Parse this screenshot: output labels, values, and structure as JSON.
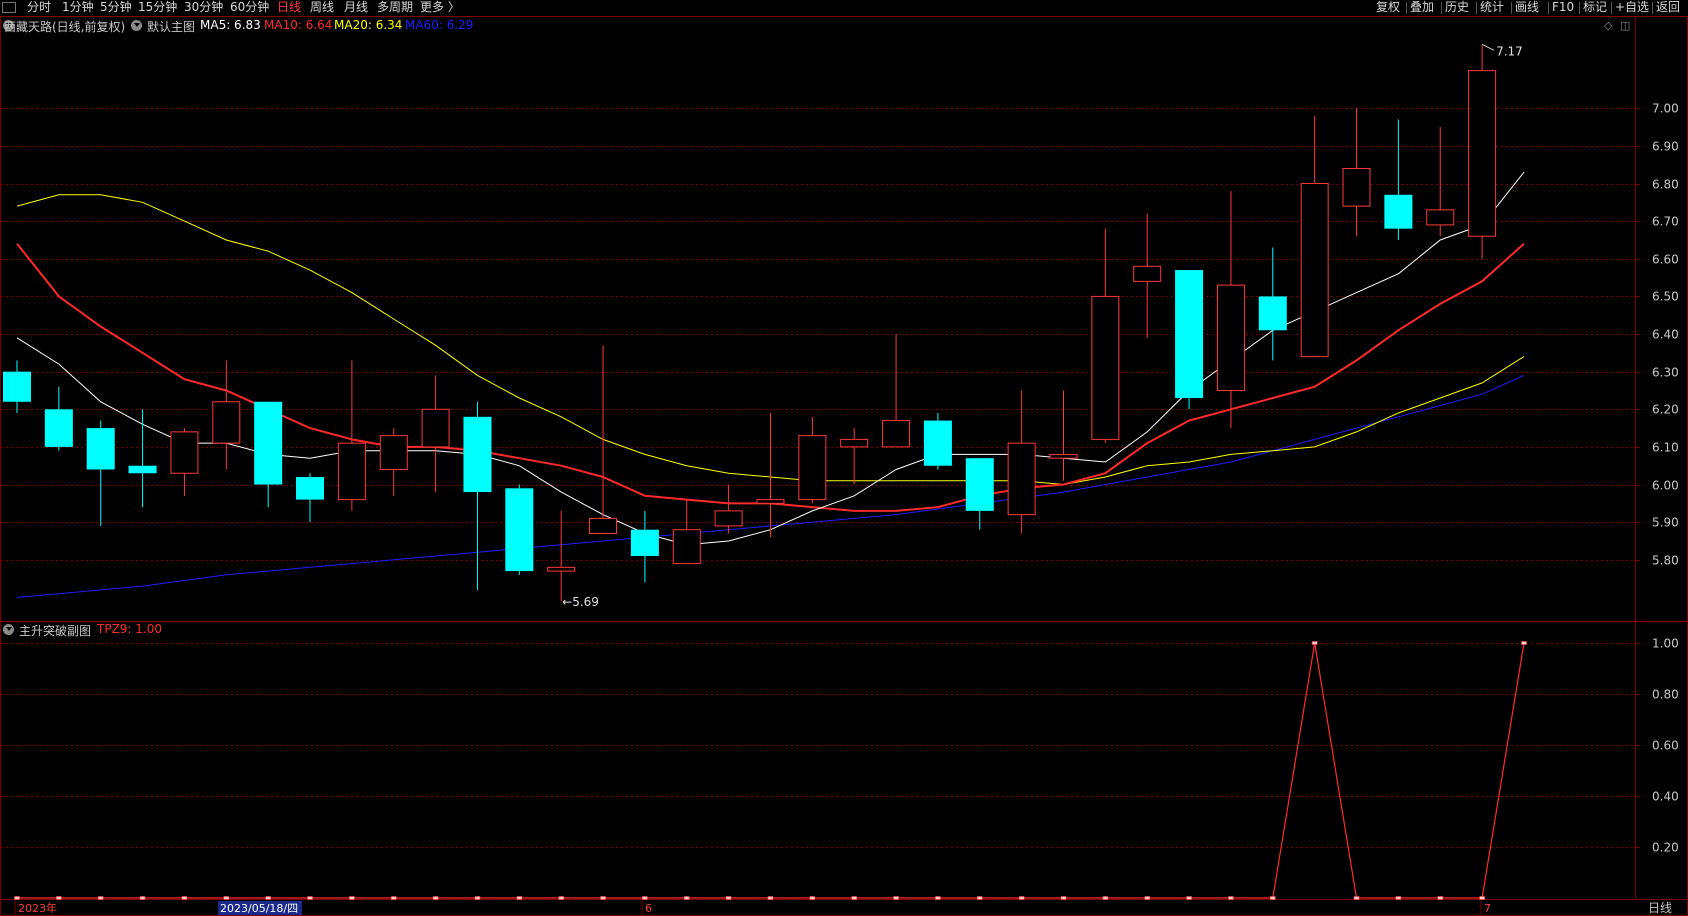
{
  "toolbar": {
    "left_items": [
      "分时",
      "1分钟",
      "5分钟",
      "15分钟",
      "30分钟",
      "60分钟",
      "日线",
      "周线",
      "月线",
      "多周期",
      "更多 〉"
    ],
    "active_item": "日线",
    "right_items": [
      "复权",
      "叠加",
      "历史",
      "统计",
      "画线",
      "F10",
      "标记",
      "+自选",
      "返回"
    ]
  },
  "main_header": {
    "stock": "西藏天路(日线,前复权)",
    "template": "默认主图",
    "ma": [
      {
        "label": "MA5: 6.83",
        "color": "#ffffff"
      },
      {
        "label": "MA10: 6.64",
        "color": "#ff2a2a"
      },
      {
        "label": "MA20: 6.34",
        "color": "#ffff00"
      },
      {
        "label": "MA60: 6.29",
        "color": "#1e1eff"
      }
    ]
  },
  "sub_header": {
    "template": "主升突破副图",
    "indicator": "TPZ9: 1.00",
    "indicator_color": "#ff2a2a"
  },
  "bottom_bar": {
    "labels": [
      "2023年",
      "6",
      "7"
    ],
    "cursor_date": "2023/05/18/四",
    "period_label": "日线"
  },
  "colors": {
    "up": "#ff3838",
    "down": "#00ffff",
    "grid": "#7a0000",
    "axis_text": "#c8c8c8"
  },
  "chart_data": {
    "type": "candlestick",
    "price_axis": {
      "ticks": [
        "5.80",
        "5.90",
        "6.00",
        "6.10",
        "6.20",
        "6.30",
        "6.40",
        "6.50",
        "6.60",
        "6.70",
        "6.80",
        "6.90",
        "7.00"
      ],
      "range": [
        5.64,
        7.2
      ]
    },
    "annotations": {
      "high": "7.17",
      "low": "5.69"
    },
    "candles": [
      {
        "o": 6.3,
        "h": 6.33,
        "l": 6.19,
        "c": 6.22
      },
      {
        "o": 6.2,
        "h": 6.26,
        "l": 6.09,
        "c": 6.1
      },
      {
        "o": 6.15,
        "h": 6.17,
        "l": 5.89,
        "c": 6.04
      },
      {
        "o": 6.05,
        "h": 6.2,
        "l": 5.94,
        "c": 6.03
      },
      {
        "o": 6.03,
        "h": 6.15,
        "l": 5.97,
        "c": 6.14
      },
      {
        "o": 6.11,
        "h": 6.33,
        "l": 6.04,
        "c": 6.22
      },
      {
        "o": 6.22,
        "h": 6.21,
        "l": 5.94,
        "c": 6.0
      },
      {
        "o": 6.02,
        "h": 6.03,
        "l": 5.9,
        "c": 5.96
      },
      {
        "o": 5.96,
        "h": 6.33,
        "l": 5.93,
        "c": 6.11
      },
      {
        "o": 6.04,
        "h": 6.15,
        "l": 5.97,
        "c": 6.13
      },
      {
        "o": 6.1,
        "h": 6.29,
        "l": 5.98,
        "c": 6.2
      },
      {
        "o": 6.18,
        "h": 6.22,
        "l": 5.72,
        "c": 5.98
      },
      {
        "o": 5.99,
        "h": 6.0,
        "l": 5.76,
        "c": 5.77
      },
      {
        "o": 5.77,
        "h": 5.93,
        "l": 5.69,
        "c": 5.78
      },
      {
        "o": 5.87,
        "h": 6.37,
        "l": 5.87,
        "c": 5.91
      },
      {
        "o": 5.88,
        "h": 5.93,
        "l": 5.74,
        "c": 5.81
      },
      {
        "o": 5.79,
        "h": 5.96,
        "l": 5.79,
        "c": 5.88
      },
      {
        "o": 5.89,
        "h": 6.0,
        "l": 5.87,
        "c": 5.93
      },
      {
        "o": 5.95,
        "h": 6.19,
        "l": 5.86,
        "c": 5.96
      },
      {
        "o": 5.96,
        "h": 6.18,
        "l": 5.95,
        "c": 6.13
      },
      {
        "o": 6.1,
        "h": 6.15,
        "l": 6.0,
        "c": 6.12
      },
      {
        "o": 6.1,
        "h": 6.4,
        "l": 6.1,
        "c": 6.17
      },
      {
        "o": 6.17,
        "h": 6.19,
        "l": 6.04,
        "c": 6.05
      },
      {
        "o": 6.07,
        "h": 6.07,
        "l": 5.88,
        "c": 5.93
      },
      {
        "o": 5.92,
        "h": 6.25,
        "l": 5.87,
        "c": 6.11
      },
      {
        "o": 6.07,
        "h": 6.25,
        "l": 6.01,
        "c": 6.08
      },
      {
        "o": 6.12,
        "h": 6.68,
        "l": 6.11,
        "c": 6.5
      },
      {
        "o": 6.54,
        "h": 6.72,
        "l": 6.39,
        "c": 6.58
      },
      {
        "o": 6.57,
        "h": 6.57,
        "l": 6.2,
        "c": 6.23
      },
      {
        "o": 6.25,
        "h": 6.78,
        "l": 6.15,
        "c": 6.53
      },
      {
        "o": 6.5,
        "h": 6.63,
        "l": 6.33,
        "c": 6.41
      },
      {
        "o": 6.34,
        "h": 6.98,
        "l": 6.34,
        "c": 6.8
      },
      {
        "o": 6.74,
        "h": 7.0,
        "l": 6.66,
        "c": 6.84
      },
      {
        "o": 6.77,
        "h": 6.97,
        "l": 6.65,
        "c": 6.68
      },
      {
        "o": 6.69,
        "h": 6.95,
        "l": 6.66,
        "c": 6.73
      },
      {
        "o": 6.66,
        "h": 7.17,
        "l": 6.6,
        "c": 7.1
      }
    ],
    "ma_series": [
      {
        "name": "MA5",
        "color": "#ffffff",
        "width": 1,
        "values": [
          6.39,
          6.32,
          6.22,
          6.16,
          6.11,
          6.11,
          6.08,
          6.07,
          6.09,
          6.09,
          6.09,
          6.08,
          6.05,
          5.98,
          5.92,
          5.87,
          5.84,
          5.85,
          5.88,
          5.93,
          5.97,
          6.04,
          6.08,
          6.08,
          6.08,
          6.07,
          6.06,
          6.14,
          6.25,
          6.33,
          6.41,
          6.46,
          6.51,
          6.56,
          6.65,
          6.69,
          6.83
        ]
      },
      {
        "name": "MA10",
        "color": "#ff2a2a",
        "width": 2,
        "values": [
          6.64,
          6.5,
          6.42,
          6.35,
          6.28,
          6.25,
          6.2,
          6.15,
          6.12,
          6.1,
          6.1,
          6.09,
          6.07,
          6.05,
          6.02,
          5.97,
          5.96,
          5.95,
          5.95,
          5.94,
          5.93,
          5.93,
          5.94,
          5.97,
          5.99,
          6.0,
          6.03,
          6.11,
          6.17,
          6.2,
          6.23,
          6.26,
          6.33,
          6.41,
          6.48,
          6.54,
          6.64
        ]
      },
      {
        "name": "MA20",
        "color": "#ffff00",
        "width": 1,
        "values": [
          6.74,
          6.77,
          6.77,
          6.75,
          6.7,
          6.65,
          6.62,
          6.57,
          6.51,
          6.44,
          6.37,
          6.29,
          6.23,
          6.18,
          6.12,
          6.08,
          6.05,
          6.03,
          6.02,
          6.01,
          6.01,
          6.01,
          6.01,
          6.01,
          6.01,
          6.0,
          6.02,
          6.05,
          6.06,
          6.08,
          6.09,
          6.1,
          6.14,
          6.19,
          6.23,
          6.27,
          6.34
        ]
      },
      {
        "name": "MA60",
        "color": "#1e1eff",
        "width": 1,
        "values": [
          5.7,
          5.71,
          5.72,
          5.73,
          5.745,
          5.76,
          5.77,
          5.78,
          5.79,
          5.8,
          5.81,
          5.82,
          5.83,
          5.84,
          5.85,
          5.86,
          5.87,
          5.88,
          5.89,
          5.9,
          5.91,
          5.92,
          5.935,
          5.95,
          5.965,
          5.98,
          6.0,
          6.02,
          6.04,
          6.06,
          6.09,
          6.12,
          6.15,
          6.18,
          6.21,
          6.24,
          6.29
        ]
      }
    ],
    "sub_chart": {
      "name": "TPZ9",
      "ticks": [
        "0.20",
        "0.40",
        "0.60",
        "0.80",
        "1.00"
      ],
      "range": [
        0,
        1.0
      ],
      "values": [
        0,
        0,
        0,
        0,
        0,
        0,
        0,
        0,
        0,
        0,
        0,
        0,
        0,
        0,
        0,
        0,
        0,
        0,
        0,
        0,
        0,
        0,
        0,
        0,
        0,
        0,
        0,
        0,
        0,
        0,
        0,
        1,
        0,
        0,
        0,
        0,
        1
      ]
    }
  }
}
